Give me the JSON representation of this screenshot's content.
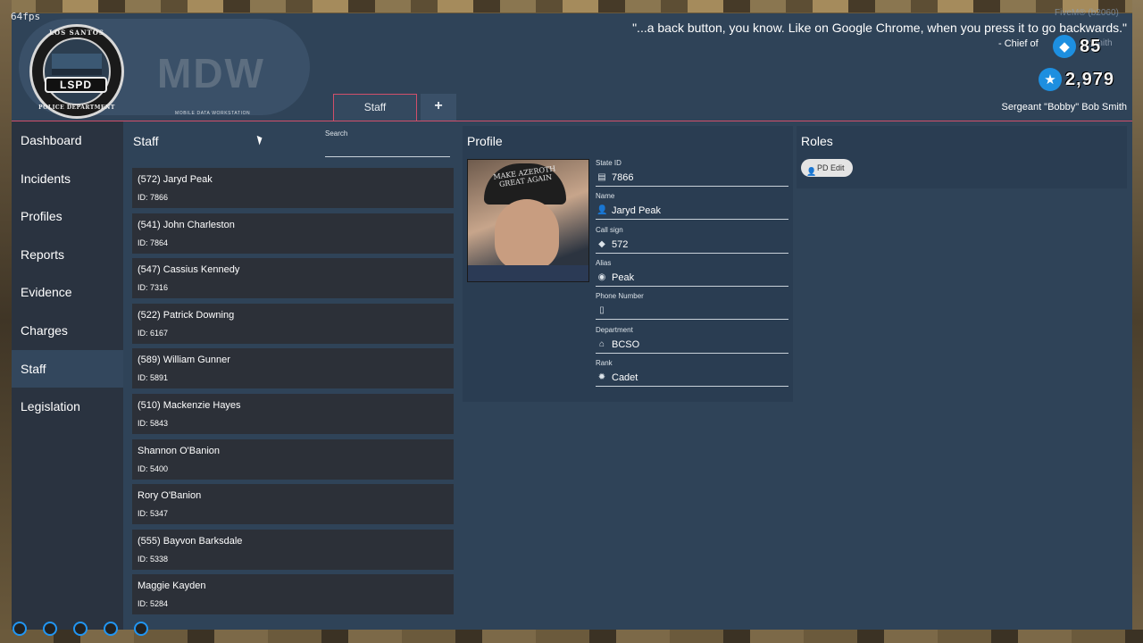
{
  "overlay": {
    "fps": "64fps",
    "quote": "\"...a back button, you know. Like on Google Chrome, when you press it to go backwards.\"",
    "quote_author": "- Chief of",
    "server_label": "FiveM® (b2060)",
    "ghost_name": "Smith",
    "gem_count": "85",
    "star_count": "2,979"
  },
  "header": {
    "badge_top_text": "LOS SANTOS",
    "badge_label": "LSPD",
    "badge_bottom_text": "POLICE DEPARTMENT",
    "app_title": "MDW",
    "app_subtitle": "MOBILE DATA WORKSTATION",
    "user": "Sergeant \"Bobby\" Bob Smith",
    "tabs": [
      {
        "label": "Staff"
      },
      {
        "label": "+"
      }
    ]
  },
  "sidebar": {
    "items": [
      {
        "label": "Dashboard"
      },
      {
        "label": "Incidents"
      },
      {
        "label": "Profiles"
      },
      {
        "label": "Reports"
      },
      {
        "label": "Evidence"
      },
      {
        "label": "Charges"
      },
      {
        "label": "Staff"
      },
      {
        "label": "Legislation"
      }
    ],
    "active": "Staff"
  },
  "staff": {
    "title": "Staff",
    "search_label": "Search",
    "search_value": "",
    "rows": [
      {
        "name": "(572) Jaryd Peak",
        "id": "ID: 7866"
      },
      {
        "name": "(541) John Charleston",
        "id": "ID: 7864"
      },
      {
        "name": "(547) Cassius Kennedy",
        "id": "ID: 7316"
      },
      {
        "name": "(522) Patrick Downing",
        "id": "ID: 6167"
      },
      {
        "name": "(589) William Gunner",
        "id": "ID: 5891"
      },
      {
        "name": "(510) Mackenzie Hayes",
        "id": "ID: 5843"
      },
      {
        "name": "Shannon O'Banion",
        "id": "ID: 5400"
      },
      {
        "name": "Rory O'Banion",
        "id": "ID: 5347"
      },
      {
        "name": "(555) Bayvon Barksdale",
        "id": "ID: 5338"
      },
      {
        "name": "Maggie Kayden",
        "id": "ID: 5284"
      }
    ]
  },
  "profile": {
    "title": "Profile",
    "hat_text": "MAKE AZEROTH GREAT AGAIN",
    "fields": [
      {
        "label": "State ID",
        "value": "7866",
        "icon": "id-card-icon",
        "glyph": "▤"
      },
      {
        "label": "Name",
        "value": "Jaryd Peak",
        "icon": "person-icon",
        "glyph": "👤"
      },
      {
        "label": "Call sign",
        "value": "572",
        "icon": "tag-icon",
        "glyph": "◆"
      },
      {
        "label": "Alias",
        "value": "Peak",
        "icon": "mask-icon",
        "glyph": "◉"
      },
      {
        "label": "Phone Number",
        "value": "",
        "icon": "phone-icon",
        "glyph": "▯"
      },
      {
        "label": "Department",
        "value": "BCSO",
        "icon": "building-icon",
        "glyph": "⌂"
      },
      {
        "label": "Rank",
        "value": "Cadet",
        "icon": "rank-icon",
        "glyph": "✹"
      }
    ]
  },
  "roles": {
    "title": "Roles",
    "items": [
      {
        "label": "PD Edit"
      }
    ]
  }
}
